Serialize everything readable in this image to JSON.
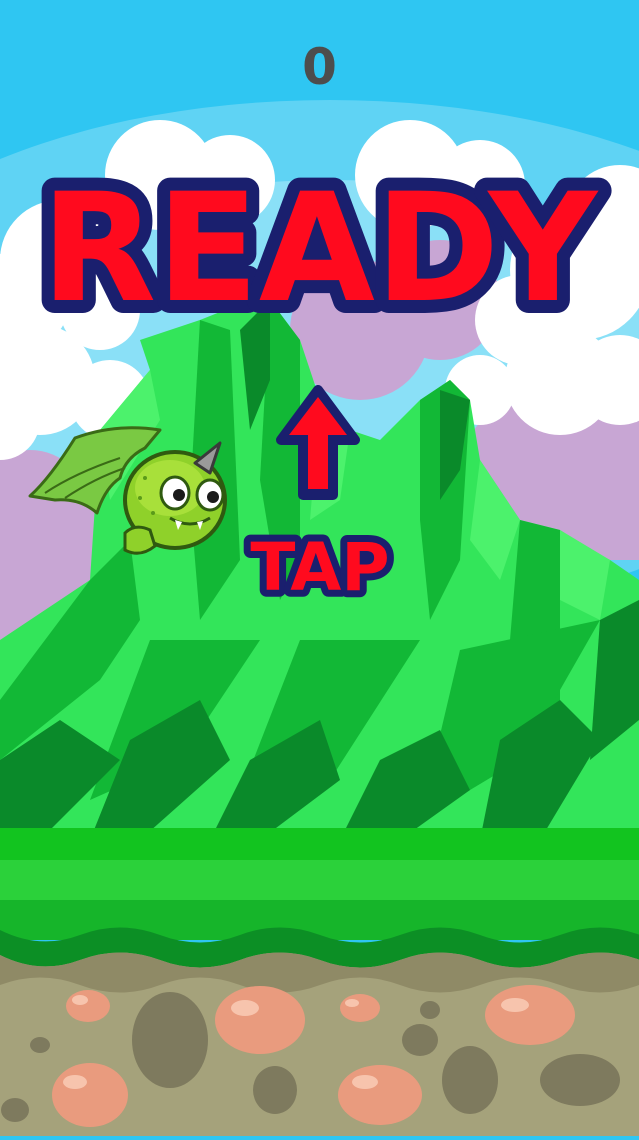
{
  "game": {
    "score": "0",
    "ready_label": "READY",
    "tap_label": "TAP"
  },
  "colors": {
    "sky": "#2fc6f2",
    "cloud": "#ffffff",
    "cloud_purple": "#c8a6d4",
    "mountain_light": "#33e55a",
    "mountain_mid": "#12b836",
    "mountain_dark": "#0a8a2a",
    "grass": "#12c41f",
    "soil": "#a5a27b",
    "rock": "#e99b7e",
    "ready_fill": "#ff0a1e",
    "ready_outline": "#1a1f6e"
  },
  "icons": [
    "dragon-sprite",
    "up-arrow-icon"
  ]
}
